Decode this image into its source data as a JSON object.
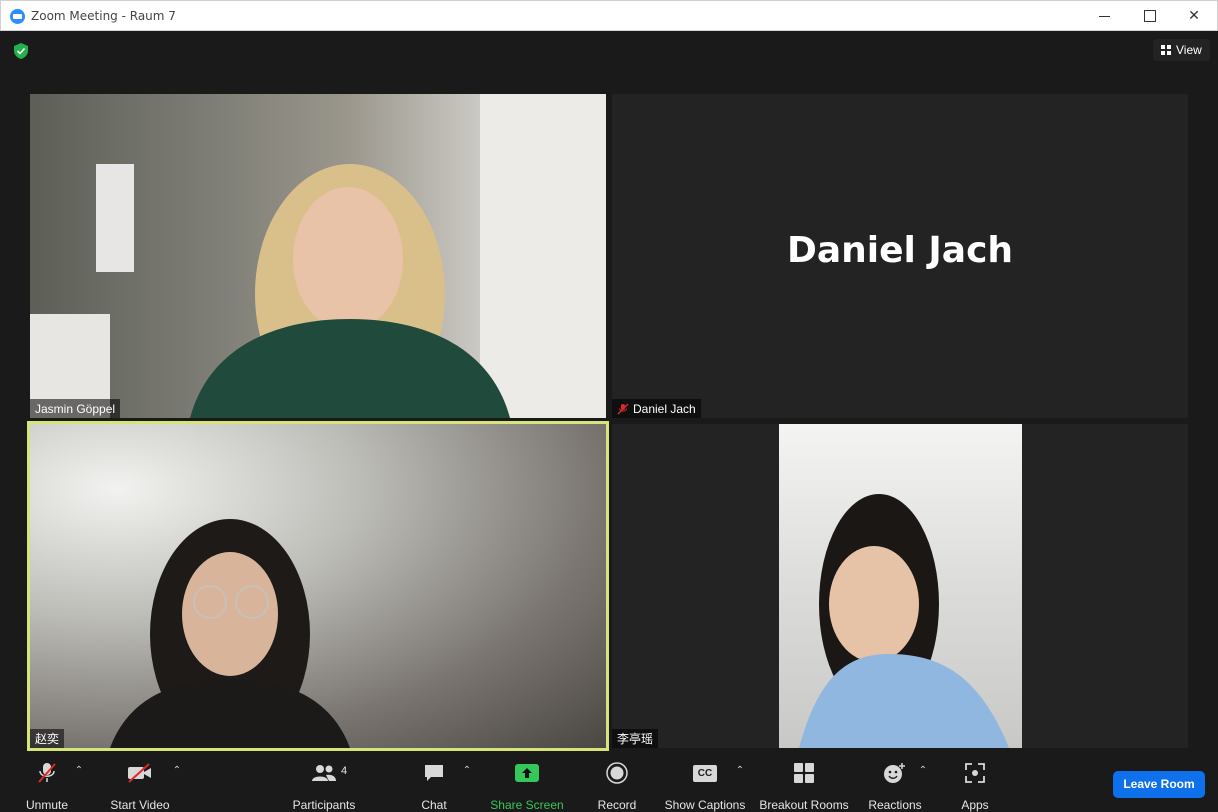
{
  "window": {
    "title": "Zoom Meeting - Raum 7",
    "controls": [
      "minimize",
      "maximize",
      "close"
    ]
  },
  "header": {
    "view_label": "View"
  },
  "participants_tiles": [
    {
      "name": "Jasmin Göppel",
      "video": true,
      "muted": false
    },
    {
      "name": "Daniel Jach",
      "display_name": "Daniel Jach",
      "video": false,
      "muted": true
    },
    {
      "name": "赵奕",
      "video": true,
      "active_speaker": true
    },
    {
      "name": "李亭瑶",
      "video": true
    }
  ],
  "toolbar": {
    "unmute": "Unmute",
    "start_video": "Start Video",
    "participants": "Participants",
    "participants_count": "4",
    "chat": "Chat",
    "share_screen": "Share Screen",
    "record": "Record",
    "show_captions": "Show Captions",
    "captions_icon_text": "CC",
    "breakout_rooms": "Breakout Rooms",
    "reactions": "Reactions",
    "apps": "Apps",
    "leave": "Leave Room"
  },
  "colors": {
    "background": "#1a1a1a",
    "tile": "#232323",
    "active_border": "#d6e57a",
    "share_green": "#35c759",
    "leave_blue": "#0e71eb",
    "mute_red": "#e02828"
  }
}
